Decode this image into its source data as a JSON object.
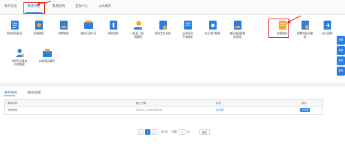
{
  "top_tabs": [
    {
      "label": "我的信息"
    },
    {
      "label": "我要办税"
    },
    {
      "label": "我要查询"
    },
    {
      "label": "互动中心"
    },
    {
      "label": "公众服务"
    }
  ],
  "icons": [
    {
      "line1": "综合信息报告",
      "line2": ""
    },
    {
      "line1": "发票使用",
      "line2": ""
    },
    {
      "line1": "税费申报",
      "line2": ""
    },
    {
      "line1": "税务行政许可",
      "line2": ""
    },
    {
      "line1": "税收减免",
      "line2": ""
    },
    {
      "line1": "一般退（抵）",
      "line2": "税管理"
    },
    {
      "line1": "预约定价安排",
      "line2": ""
    },
    {
      "line1": "证明开具",
      "line2": "开具服务"
    },
    {
      "line1": "非正常户解除",
      "line2": ""
    },
    {
      "line1": "跨区域经营税",
      "line2": "收管理"
    },
    {
      "line1": "发票使用",
      "line2": ""
    },
    {
      "line1": "税费申报及缴",
      "line2": "纳"
    },
    {
      "line1": "出口退税",
      "line2": ""
    },
    {
      "line1": "涉税专业服务",
      "line2": "机构管理"
    },
    {
      "line1": "其他服务事项",
      "line2": ""
    }
  ],
  "float_buttons": [
    "设置",
    "纳税",
    "咨询",
    "帮助"
  ],
  "sub_tabs": [
    "我的待办",
    "服务提醒"
  ],
  "table": {
    "headers": [
      "事项名称",
      "截止日期",
      "状态",
      "操作"
    ],
    "rows": [
      {
        "name": "发票使用",
        "date": "2018-11-26 00:00:00",
        "status": "待办理",
        "action": "去办理"
      }
    ]
  },
  "pager": {
    "prev": "<",
    "page": "1",
    "next": ">",
    "total_label": "共1页",
    "goto_label": "到第",
    "goto_value": "1",
    "page_unit": "页",
    "confirm": "确定"
  },
  "colors": {
    "accent": "#2a7de1",
    "highlight": "#e2231a"
  }
}
